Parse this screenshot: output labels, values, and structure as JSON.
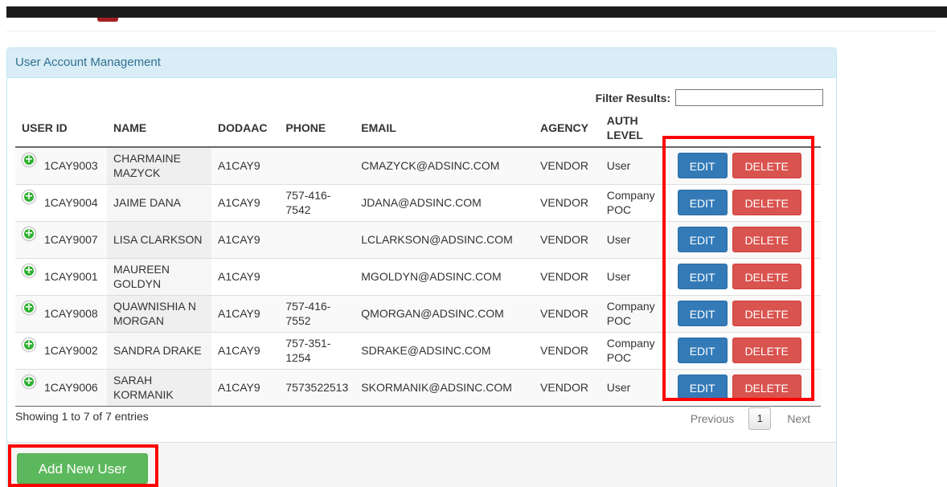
{
  "panel": {
    "title": "User Account Management"
  },
  "filter": {
    "label": "Filter Results:",
    "value": ""
  },
  "table": {
    "columns": {
      "user_id": "USER ID",
      "name": "NAME",
      "dodaac": "DODAAC",
      "phone": "PHONE",
      "email": "EMAIL",
      "agency": "AGENCY",
      "auth_level": "AUTH LEVEL"
    },
    "rows": [
      {
        "user_id": "1CAY9003",
        "name": "CHARMAINE MAZYCK",
        "dodaac": "A1CAY9",
        "phone": "",
        "email": "CMAZYCK@ADSINC.COM",
        "agency": "VENDOR",
        "auth_level": "User"
      },
      {
        "user_id": "1CAY9004",
        "name": "JAIME DANA",
        "dodaac": "A1CAY9",
        "phone": "757-416-7542",
        "email": "JDANA@ADSINC.COM",
        "agency": "VENDOR",
        "auth_level": "Company POC"
      },
      {
        "user_id": "1CAY9007",
        "name": "LISA CLARKSON",
        "dodaac": "A1CAY9",
        "phone": "",
        "email": "LCLARKSON@ADSINC.COM",
        "agency": "VENDOR",
        "auth_level": "User"
      },
      {
        "user_id": "1CAY9001",
        "name": "MAUREEN GOLDYN",
        "dodaac": "A1CAY9",
        "phone": "",
        "email": "MGOLDYN@ADSINC.COM",
        "agency": "VENDOR",
        "auth_level": "User"
      },
      {
        "user_id": "1CAY9008",
        "name": "QUAWNISHIA N MORGAN",
        "dodaac": "A1CAY9",
        "phone": "757-416-7552",
        "email": "QMORGAN@ADSINC.COM",
        "agency": "VENDOR",
        "auth_level": "Company POC"
      },
      {
        "user_id": "1CAY9002",
        "name": "SANDRA DRAKE",
        "dodaac": "A1CAY9",
        "phone": "757-351-1254",
        "email": "SDRAKE@ADSINC.COM",
        "agency": "VENDOR",
        "auth_level": "Company POC"
      },
      {
        "user_id": "1CAY9006",
        "name": "SARAH KORMANIK",
        "dodaac": "A1CAY9",
        "phone": "7573522513",
        "email": "SKORMANIK@ADSINC.COM",
        "agency": "VENDOR",
        "auth_level": "User"
      }
    ],
    "edit_label": "EDIT",
    "delete_label": "DELETE",
    "expand_icon": "plus-circle-icon"
  },
  "info": {
    "text": "Showing 1 to 7 of 7 entries"
  },
  "pagination": {
    "previous": "Previous",
    "current_page": "1",
    "next": "Next"
  },
  "footer": {
    "add_user_label": "Add New User"
  },
  "colors": {
    "edit_button": "#337ab7",
    "delete_button": "#d9534f",
    "add_button": "#5cb85c",
    "panel_heading": "#d9edf7",
    "highlight": "#ff0000"
  }
}
